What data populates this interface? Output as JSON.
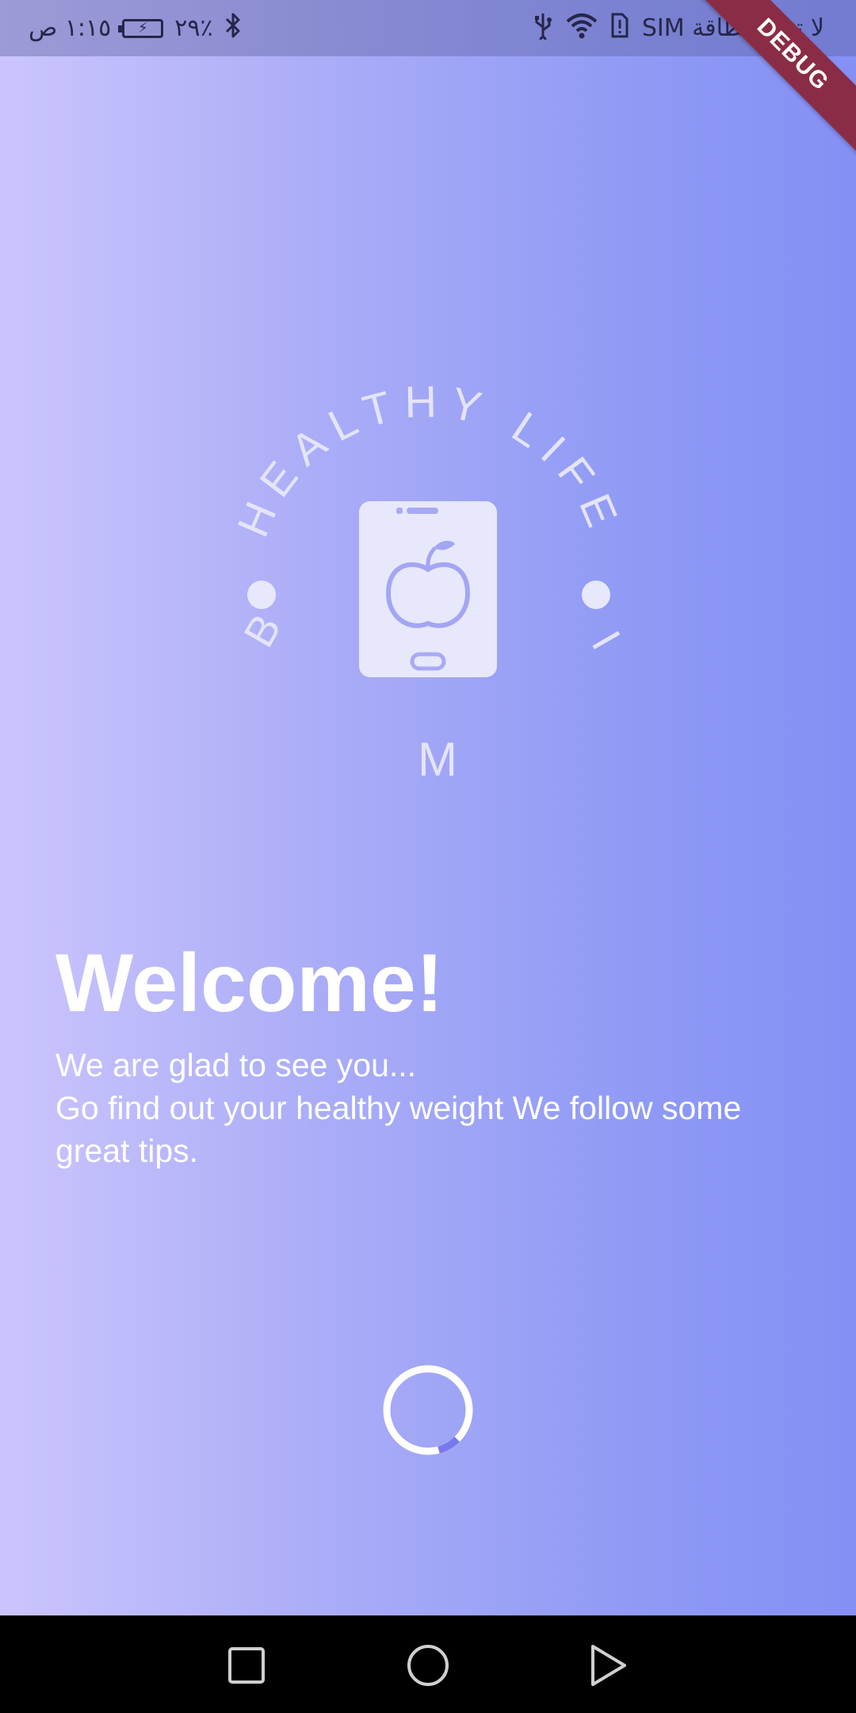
{
  "status_bar": {
    "time": "١:١٥ ص",
    "battery_percent": "٢٩٪",
    "carrier_text": "لا توجد بطاقة SIM",
    "icons": [
      "bluetooth-icon",
      "battery-icon",
      "usb-icon",
      "wifi-icon",
      "sim-alert-icon"
    ]
  },
  "debug_banner": "DEBUG",
  "logo": {
    "arc_text": "HEALTHY LIFE",
    "letter_left": "B",
    "letter_bottom": "M",
    "letter_right": "I",
    "icon": "phone-apple-icon"
  },
  "welcome": {
    "title": "Welcome!",
    "line1": "We are glad to see you...",
    "line2": "Go find out your healthy weight We follow some great tips."
  },
  "loading": {
    "icon": "loading-spinner"
  },
  "nav_bar": {
    "icons": [
      "recent-apps-icon",
      "home-icon",
      "back-icon"
    ]
  },
  "colors": {
    "gradient_start": "#cbc5fd",
    "gradient_end": "#8490f4",
    "spinner_accent": "#7a78ee",
    "logo_fill": "#e8e8fc"
  }
}
